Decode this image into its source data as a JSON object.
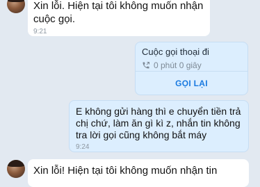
{
  "messages": [
    {
      "sender": "contact",
      "text": "Xin lỗi. Hiện tại tôi không muốn nhận cuộc gọi.",
      "time": "9:21"
    },
    {
      "sender": "me",
      "call": {
        "title": "Cuộc gọi thoại đi",
        "duration": "0 phút 0 giây",
        "icon": "outgoing-call-icon",
        "action_label": "GỌI LẠI"
      }
    },
    {
      "sender": "me",
      "text": "E không gửi hàng thì e chuyển tiền trả chị chứ, làm ăn gì kì z, nhắn tin không tra lời gọi cũng không bắt máy",
      "time": "9:24"
    },
    {
      "sender": "contact",
      "text": "Xin lỗi! Hiện tại tôi không muốn nhận tin"
    }
  ],
  "colors": {
    "background": "#e2e9f1",
    "received_bubble": "#ffffff",
    "sent_bubble": "#dceefe",
    "accent": "#1a7ae0"
  }
}
